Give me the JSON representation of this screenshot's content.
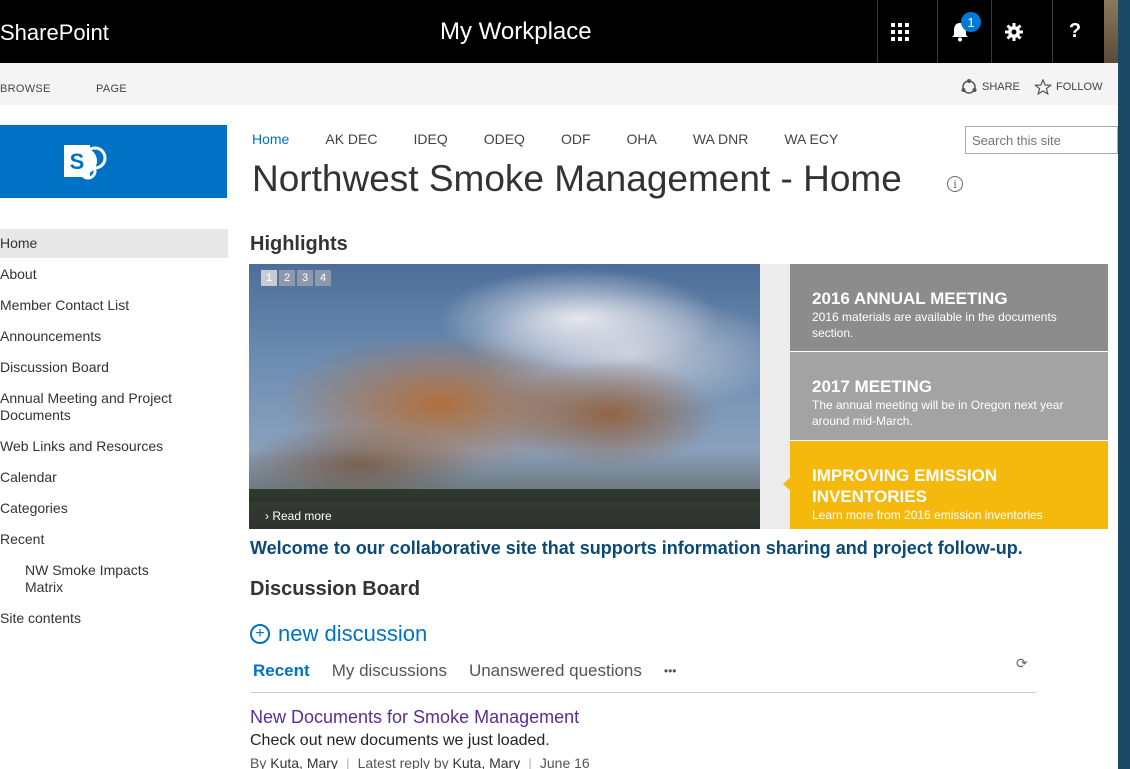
{
  "suite_bar": {
    "brand": "SharePoint",
    "title": "My Workplace",
    "notification_count": "1"
  },
  "ribbon": {
    "tabs": [
      "BROWSE",
      "PAGE"
    ],
    "share_label": "SHARE",
    "follow_label": "FOLLOW"
  },
  "site": {
    "logo_letter": "S"
  },
  "left_nav": {
    "items": [
      {
        "label": "Home"
      },
      {
        "label": "About"
      },
      {
        "label": "Member Contact List"
      },
      {
        "label": "Announcements"
      },
      {
        "label": "Discussion Board"
      },
      {
        "label": "Annual Meeting and Project Documents"
      },
      {
        "label": "Web Links and Resources"
      },
      {
        "label": "Calendar"
      },
      {
        "label": "Categories"
      },
      {
        "label": "Recent"
      },
      {
        "label": "NW Smoke Impacts Matrix"
      },
      {
        "label": "Site contents"
      }
    ]
  },
  "top_nav": {
    "items": [
      "Home",
      "AK DEC",
      "IDEQ",
      "ODEQ",
      "ODF",
      "OHA",
      "WA DNR",
      "WA ECY"
    ]
  },
  "search": {
    "placeholder": "Search this site"
  },
  "page": {
    "title": "Northwest Smoke Management - Home",
    "highlights_heading": "Highlights"
  },
  "carousel": {
    "pages": [
      "1",
      "2",
      "3",
      "4"
    ],
    "read_more": "Read more",
    "panels": [
      {
        "title": "2016 ANNUAL MEETING",
        "desc": "2016 materials are available in the documents section.",
        "color": "#8c8c8c"
      },
      {
        "title": "2017 MEETING",
        "desc": "The annual meeting will be in Oregon next year around mid-March.",
        "color": "#a3a3a3"
      },
      {
        "title": "IMPROVING EMISSION INVENTORIES",
        "desc": "Learn more from 2016 emission inventories",
        "color": "#f5b90e"
      }
    ]
  },
  "welcome": "Welcome to our collaborative site that supports information sharing and project follow-up.",
  "discussion": {
    "heading": "Discussion Board",
    "new_label": "new discussion",
    "tabs": [
      "Recent",
      "My discussions",
      "Unanswered questions"
    ],
    "more": "•••",
    "post": {
      "title": "New Documents for Smoke Management",
      "body": "Check out new documents we just loaded.",
      "by_prefix": "By",
      "author": "Kuta, Mary",
      "reply_prefix": "Latest reply by",
      "reply_author": "Kuta, Mary",
      "date": "June 16"
    }
  },
  "colors": {
    "accent": "#0072c6",
    "suite_bar": "#000000",
    "welcome": "#0b4a78",
    "post_title": "#5c2d91"
  }
}
